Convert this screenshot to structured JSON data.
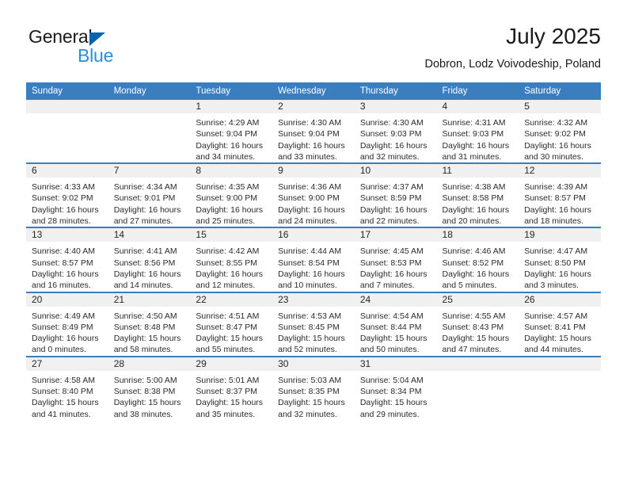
{
  "brand": {
    "name_top": "General",
    "name_bottom": "Blue",
    "triangle_color": "#0a63ad",
    "bottom_color": "#2a8fd4"
  },
  "header": {
    "title": "July 2025",
    "subtitle": "Dobron, Lodz Voivodeship, Poland"
  },
  "theme": {
    "header_bg": "#3a7ebf",
    "daynum_bg": "#f0f0f0",
    "rule_color": "#3a7ebf"
  },
  "weekdays": [
    "Sunday",
    "Monday",
    "Tuesday",
    "Wednesday",
    "Thursday",
    "Friday",
    "Saturday"
  ],
  "weeks": [
    [
      {
        "day": "",
        "sunrise": "",
        "sunset": "",
        "daylight_line1": "",
        "daylight_line2": ""
      },
      {
        "day": "",
        "sunrise": "",
        "sunset": "",
        "daylight_line1": "",
        "daylight_line2": ""
      },
      {
        "day": "1",
        "sunrise": "Sunrise: 4:29 AM",
        "sunset": "Sunset: 9:04 PM",
        "daylight_line1": "Daylight: 16 hours",
        "daylight_line2": "and 34 minutes."
      },
      {
        "day": "2",
        "sunrise": "Sunrise: 4:30 AM",
        "sunset": "Sunset: 9:04 PM",
        "daylight_line1": "Daylight: 16 hours",
        "daylight_line2": "and 33 minutes."
      },
      {
        "day": "3",
        "sunrise": "Sunrise: 4:30 AM",
        "sunset": "Sunset: 9:03 PM",
        "daylight_line1": "Daylight: 16 hours",
        "daylight_line2": "and 32 minutes."
      },
      {
        "day": "4",
        "sunrise": "Sunrise: 4:31 AM",
        "sunset": "Sunset: 9:03 PM",
        "daylight_line1": "Daylight: 16 hours",
        "daylight_line2": "and 31 minutes."
      },
      {
        "day": "5",
        "sunrise": "Sunrise: 4:32 AM",
        "sunset": "Sunset: 9:02 PM",
        "daylight_line1": "Daylight: 16 hours",
        "daylight_line2": "and 30 minutes."
      }
    ],
    [
      {
        "day": "6",
        "sunrise": "Sunrise: 4:33 AM",
        "sunset": "Sunset: 9:02 PM",
        "daylight_line1": "Daylight: 16 hours",
        "daylight_line2": "and 28 minutes."
      },
      {
        "day": "7",
        "sunrise": "Sunrise: 4:34 AM",
        "sunset": "Sunset: 9:01 PM",
        "daylight_line1": "Daylight: 16 hours",
        "daylight_line2": "and 27 minutes."
      },
      {
        "day": "8",
        "sunrise": "Sunrise: 4:35 AM",
        "sunset": "Sunset: 9:00 PM",
        "daylight_line1": "Daylight: 16 hours",
        "daylight_line2": "and 25 minutes."
      },
      {
        "day": "9",
        "sunrise": "Sunrise: 4:36 AM",
        "sunset": "Sunset: 9:00 PM",
        "daylight_line1": "Daylight: 16 hours",
        "daylight_line2": "and 24 minutes."
      },
      {
        "day": "10",
        "sunrise": "Sunrise: 4:37 AM",
        "sunset": "Sunset: 8:59 PM",
        "daylight_line1": "Daylight: 16 hours",
        "daylight_line2": "and 22 minutes."
      },
      {
        "day": "11",
        "sunrise": "Sunrise: 4:38 AM",
        "sunset": "Sunset: 8:58 PM",
        "daylight_line1": "Daylight: 16 hours",
        "daylight_line2": "and 20 minutes."
      },
      {
        "day": "12",
        "sunrise": "Sunrise: 4:39 AM",
        "sunset": "Sunset: 8:57 PM",
        "daylight_line1": "Daylight: 16 hours",
        "daylight_line2": "and 18 minutes."
      }
    ],
    [
      {
        "day": "13",
        "sunrise": "Sunrise: 4:40 AM",
        "sunset": "Sunset: 8:57 PM",
        "daylight_line1": "Daylight: 16 hours",
        "daylight_line2": "and 16 minutes."
      },
      {
        "day": "14",
        "sunrise": "Sunrise: 4:41 AM",
        "sunset": "Sunset: 8:56 PM",
        "daylight_line1": "Daylight: 16 hours",
        "daylight_line2": "and 14 minutes."
      },
      {
        "day": "15",
        "sunrise": "Sunrise: 4:42 AM",
        "sunset": "Sunset: 8:55 PM",
        "daylight_line1": "Daylight: 16 hours",
        "daylight_line2": "and 12 minutes."
      },
      {
        "day": "16",
        "sunrise": "Sunrise: 4:44 AM",
        "sunset": "Sunset: 8:54 PM",
        "daylight_line1": "Daylight: 16 hours",
        "daylight_line2": "and 10 minutes."
      },
      {
        "day": "17",
        "sunrise": "Sunrise: 4:45 AM",
        "sunset": "Sunset: 8:53 PM",
        "daylight_line1": "Daylight: 16 hours",
        "daylight_line2": "and 7 minutes."
      },
      {
        "day": "18",
        "sunrise": "Sunrise: 4:46 AM",
        "sunset": "Sunset: 8:52 PM",
        "daylight_line1": "Daylight: 16 hours",
        "daylight_line2": "and 5 minutes."
      },
      {
        "day": "19",
        "sunrise": "Sunrise: 4:47 AM",
        "sunset": "Sunset: 8:50 PM",
        "daylight_line1": "Daylight: 16 hours",
        "daylight_line2": "and 3 minutes."
      }
    ],
    [
      {
        "day": "20",
        "sunrise": "Sunrise: 4:49 AM",
        "sunset": "Sunset: 8:49 PM",
        "daylight_line1": "Daylight: 16 hours",
        "daylight_line2": "and 0 minutes."
      },
      {
        "day": "21",
        "sunrise": "Sunrise: 4:50 AM",
        "sunset": "Sunset: 8:48 PM",
        "daylight_line1": "Daylight: 15 hours",
        "daylight_line2": "and 58 minutes."
      },
      {
        "day": "22",
        "sunrise": "Sunrise: 4:51 AM",
        "sunset": "Sunset: 8:47 PM",
        "daylight_line1": "Daylight: 15 hours",
        "daylight_line2": "and 55 minutes."
      },
      {
        "day": "23",
        "sunrise": "Sunrise: 4:53 AM",
        "sunset": "Sunset: 8:45 PM",
        "daylight_line1": "Daylight: 15 hours",
        "daylight_line2": "and 52 minutes."
      },
      {
        "day": "24",
        "sunrise": "Sunrise: 4:54 AM",
        "sunset": "Sunset: 8:44 PM",
        "daylight_line1": "Daylight: 15 hours",
        "daylight_line2": "and 50 minutes."
      },
      {
        "day": "25",
        "sunrise": "Sunrise: 4:55 AM",
        "sunset": "Sunset: 8:43 PM",
        "daylight_line1": "Daylight: 15 hours",
        "daylight_line2": "and 47 minutes."
      },
      {
        "day": "26",
        "sunrise": "Sunrise: 4:57 AM",
        "sunset": "Sunset: 8:41 PM",
        "daylight_line1": "Daylight: 15 hours",
        "daylight_line2": "and 44 minutes."
      }
    ],
    [
      {
        "day": "27",
        "sunrise": "Sunrise: 4:58 AM",
        "sunset": "Sunset: 8:40 PM",
        "daylight_line1": "Daylight: 15 hours",
        "daylight_line2": "and 41 minutes."
      },
      {
        "day": "28",
        "sunrise": "Sunrise: 5:00 AM",
        "sunset": "Sunset: 8:38 PM",
        "daylight_line1": "Daylight: 15 hours",
        "daylight_line2": "and 38 minutes."
      },
      {
        "day": "29",
        "sunrise": "Sunrise: 5:01 AM",
        "sunset": "Sunset: 8:37 PM",
        "daylight_line1": "Daylight: 15 hours",
        "daylight_line2": "and 35 minutes."
      },
      {
        "day": "30",
        "sunrise": "Sunrise: 5:03 AM",
        "sunset": "Sunset: 8:35 PM",
        "daylight_line1": "Daylight: 15 hours",
        "daylight_line2": "and 32 minutes."
      },
      {
        "day": "31",
        "sunrise": "Sunrise: 5:04 AM",
        "sunset": "Sunset: 8:34 PM",
        "daylight_line1": "Daylight: 15 hours",
        "daylight_line2": "and 29 minutes."
      },
      {
        "day": "",
        "sunrise": "",
        "sunset": "",
        "daylight_line1": "",
        "daylight_line2": ""
      },
      {
        "day": "",
        "sunrise": "",
        "sunset": "",
        "daylight_line1": "",
        "daylight_line2": ""
      }
    ]
  ]
}
